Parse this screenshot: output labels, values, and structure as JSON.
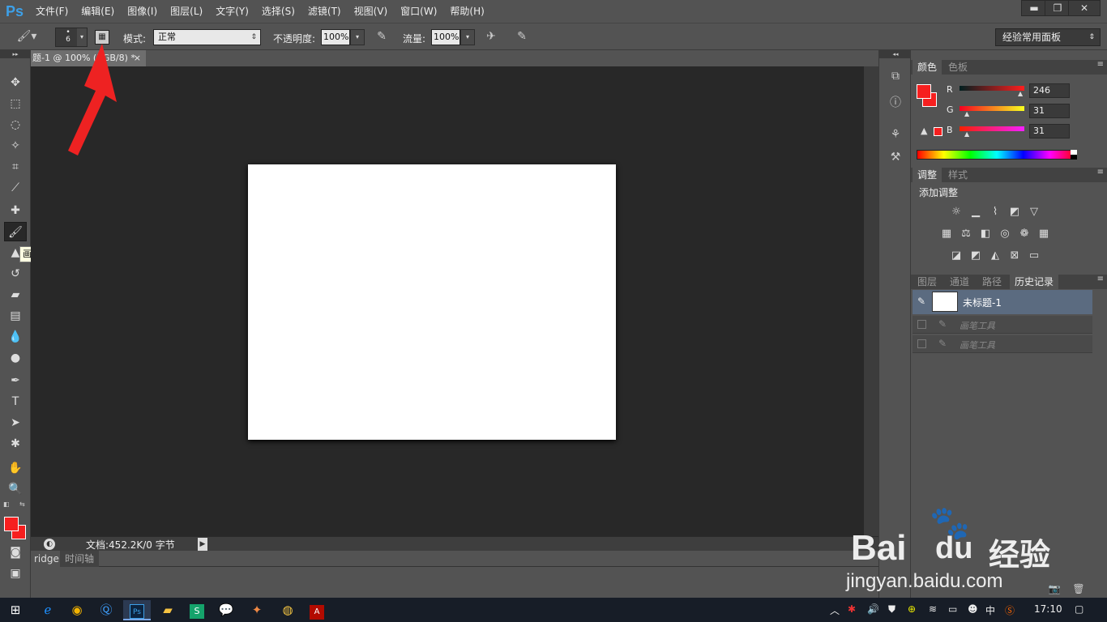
{
  "app": {
    "logo": "Ps",
    "menus": [
      "文件(F)",
      "编辑(E)",
      "图像(I)",
      "图层(L)",
      "文字(Y)",
      "选择(S)",
      "滤镜(T)",
      "视图(V)",
      "窗口(W)",
      "帮助(H)"
    ],
    "win_min": "▬",
    "win_max": "❐",
    "win_close": "✕"
  },
  "options": {
    "brush_size": "6",
    "mode_label": "模式:",
    "mode_value": "正常",
    "opacity_label": "不透明度:",
    "opacity_value": "100%",
    "flow_label": "流量:",
    "flow_value": "100%",
    "workspace": "经验常用面板"
  },
  "document": {
    "tab_title": "题-1 @ 100% (RGB/8) *",
    "tab_close": "×",
    "status": "文档:452.2K/0 字节"
  },
  "tooltip": "画笔工具 (B)",
  "bottom_tabs": [
    "ridge",
    "时间轴"
  ],
  "color_panel": {
    "tabs": [
      "颜色",
      "色板"
    ],
    "r_label": "R",
    "g_label": "G",
    "b_label": "B",
    "r": "246",
    "g": "31",
    "b": "31",
    "fg_color": "#f61f1f"
  },
  "adjust_panel": {
    "tabs": [
      "调整",
      "样式"
    ],
    "title": "添加调整"
  },
  "history_panel": {
    "tabs": [
      "图层",
      "通道",
      "路径",
      "历史记录"
    ],
    "snapshot": "未标题-1",
    "items": [
      "画笔工具",
      "画笔工具"
    ]
  },
  "watermark": {
    "brand": "Bai",
    "brand2": "du",
    "brand3": "经验",
    "url": "jingyan.baidu.com"
  },
  "taskbar": {
    "ime": "中",
    "time": "17:10"
  }
}
